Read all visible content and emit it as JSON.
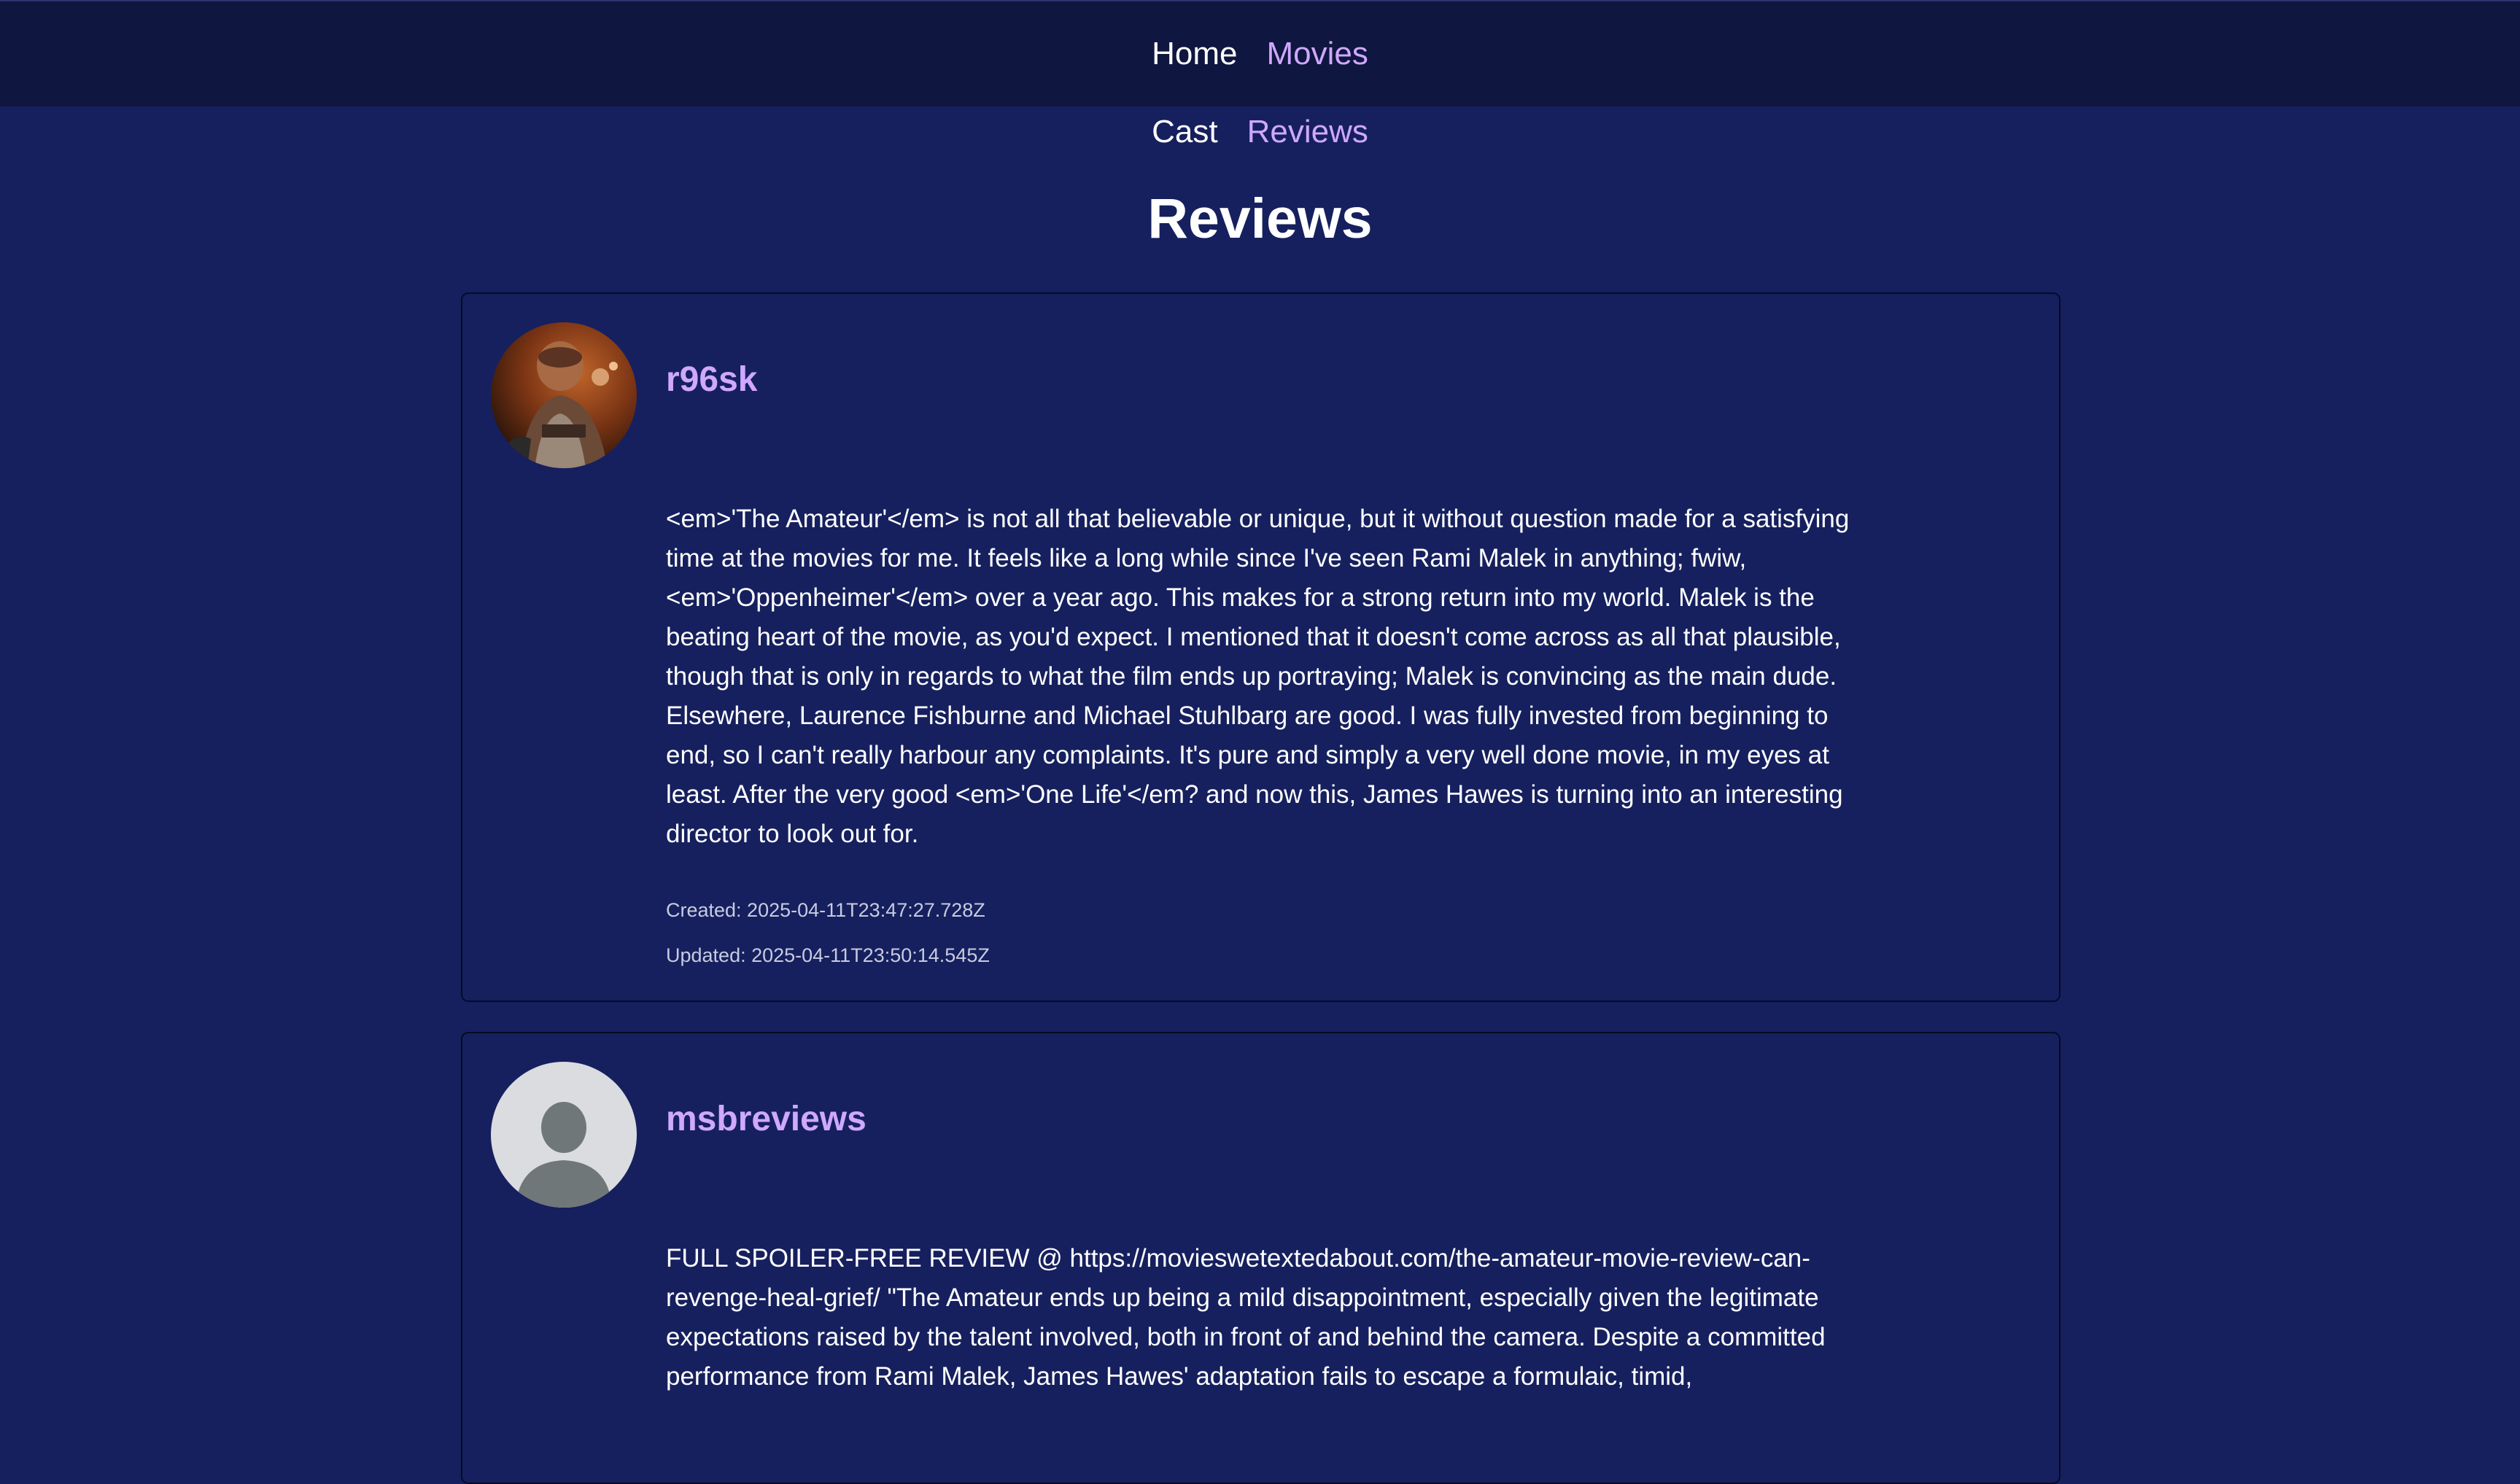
{
  "nav": {
    "home": "Home",
    "movies": "Movies"
  },
  "subnav": {
    "cast": "Cast",
    "reviews": "Reviews"
  },
  "page_title": "Reviews",
  "reviews": [
    {
      "author": "r96sk",
      "avatar": "user-photo-avatar",
      "content": "<em>'The Amateur'</em> is not all that believable or unique, but it without question made for a satisfying time at the movies for me. It feels like a long while since I've seen Rami Malek in anything; fwiw, <em>'Oppenheimer'</em> over a year ago. This makes for a strong return into my world. Malek is the beating heart of the movie, as you'd expect. I mentioned that it doesn't come across as all that plausible, though that is only in regards to what the film ends up portraying; Malek is convincing as the main dude. Elsewhere, Laurence Fishburne and Michael Stuhlbarg are good. I was fully invested from beginning to end, so I can't really harbour any complaints. It's pure and simply a very well done movie, in my eyes at least. After the very good <em>'One Life'</em? and now this, James Hawes is turning into an interesting director to look out for.",
      "created": "Created: 2025-04-11T23:47:27.728Z",
      "updated": "Updated: 2025-04-11T23:50:14.545Z"
    },
    {
      "author": "msbreviews",
      "avatar": "default-user-icon",
      "content": "FULL SPOILER-FREE REVIEW @ https://movieswetextedabout.com/the-amateur-movie-review-can-revenge-heal-grief/ \"The Amateur ends up being a mild disappointment, especially given the legitimate expectations raised by the talent involved, both in front of and behind the camera. Despite a committed performance from Rami Malek, James Hawes' adaptation fails to escape a formulaic, timid,"
    }
  ],
  "colors": {
    "page_bg": "#16205e",
    "topbar_bg": "#0f163f",
    "accent": "#cfa8ff",
    "card_border": "#060a26"
  }
}
